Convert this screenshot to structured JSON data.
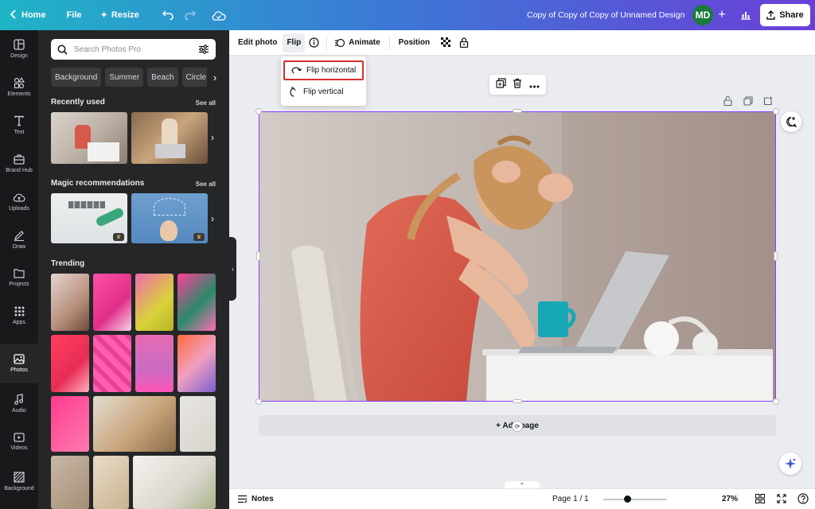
{
  "topbar": {
    "home_label": "Home",
    "file_label": "File",
    "resize_label": "Resize",
    "title": "Copy of Copy of Copy of Unnamed Design",
    "avatar_initials": "MD",
    "share_label": "Share"
  },
  "rail": {
    "items": [
      {
        "label": "Design",
        "icon": "layout-icon"
      },
      {
        "label": "Elements",
        "icon": "shapes-icon"
      },
      {
        "label": "Text",
        "icon": "text-icon"
      },
      {
        "label": "Brand Hub",
        "icon": "briefcase-icon"
      },
      {
        "label": "Uploads",
        "icon": "cloud-upload-icon"
      },
      {
        "label": "Draw",
        "icon": "pen-icon"
      },
      {
        "label": "Projects",
        "icon": "folder-icon"
      },
      {
        "label": "Apps",
        "icon": "grid-icon"
      },
      {
        "label": "Photos",
        "icon": "image-icon",
        "active": true
      },
      {
        "label": "Audio",
        "icon": "music-icon"
      },
      {
        "label": "Videos",
        "icon": "video-icon"
      },
      {
        "label": "Background",
        "icon": "background-icon"
      }
    ]
  },
  "panel": {
    "search_placeholder": "Search Photos Pro",
    "chips": [
      "Background",
      "Summer",
      "Beach",
      "Circle"
    ],
    "recently_used": "Recently used",
    "magic_recommendations": "Magic recommendations",
    "trending": "Trending",
    "see_all": "See all"
  },
  "toolbar": {
    "edit_photo": "Edit photo",
    "flip": "Flip",
    "animate": "Animate",
    "position": "Position"
  },
  "flip_menu": {
    "horizontal": "Flip horizontal",
    "vertical": "Flip vertical"
  },
  "canvas": {
    "add_page": "+ Add page"
  },
  "bottombar": {
    "notes": "Notes",
    "page_indicator": "Page 1 / 1",
    "zoom": "27%",
    "zoom_level": 0.27
  },
  "colors": {
    "accent": "#8b3dff",
    "panel_bg": "#252627",
    "rail_bg": "#18191b",
    "highlight": "#d32f2f"
  }
}
